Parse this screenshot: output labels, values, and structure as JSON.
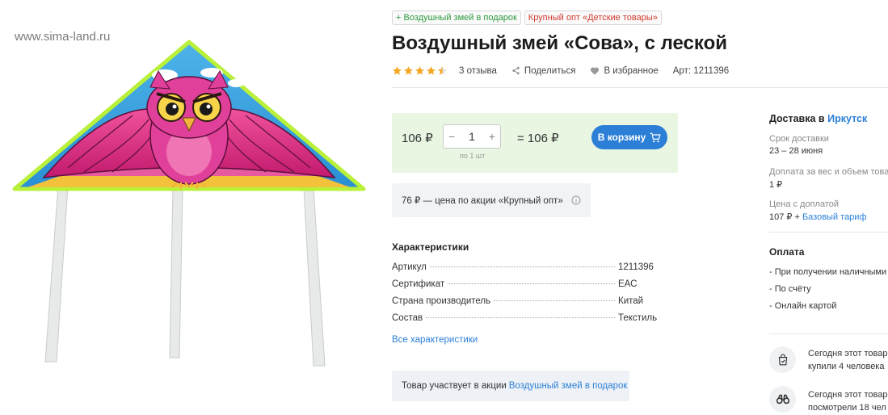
{
  "watermark": "www.sima-land.ru",
  "promo_tags": {
    "gift": "+ Воздушный змей в подарок",
    "wholesale": "Крупный опт «Детские товары»"
  },
  "product": {
    "title": "Воздушный змей «Сова», с леской",
    "rating": 4.5,
    "reviews": "3 отзыва",
    "share": "Поделиться",
    "favorite": "В избранное",
    "article": "Арт: 1211396"
  },
  "buy": {
    "price": "106 ₽",
    "qty_minus": "−",
    "quantity": "1",
    "qty_plus": "+",
    "step_note": "по 1 шт",
    "total": "= 106 ₽",
    "cart_button": "В корзину"
  },
  "promo_price": {
    "text": "76 ₽ — цена по акции «Крупный опт»",
    "info_icon": "info-icon"
  },
  "characteristics": {
    "title": "Характеристики",
    "rows": [
      {
        "key": "Артикул",
        "value": "1211396"
      },
      {
        "key": "Сертификат",
        "value": "ЕАС"
      },
      {
        "key": "Страна производитель",
        "value": "Китай"
      },
      {
        "key": "Состав",
        "value": "Текстиль"
      }
    ],
    "all_link": "Все характеристики"
  },
  "action": {
    "text": "Товар участвует в акции",
    "link": "Воздушный змей в подарок"
  },
  "sidebar": {
    "delivery_label": "Доставка в",
    "city": "Иркутск",
    "term_label": "Срок доставки",
    "term_value": "23 – 28 июня",
    "extra_label": "Доплата за вес и объем това",
    "extra_value": "1 ₽",
    "price_label": "Цена с доплатой",
    "price_value": "107 ₽ +",
    "tariff_link": "Базовый тариф",
    "payment_title": "Оплата",
    "payment_items": [
      "- При получении наличными",
      "- По счёту",
      "- Онлайн картой"
    ],
    "stats": [
      {
        "line1": "Сегодня этот товар",
        "line2": "купили 4 человека",
        "icon": "shopping-bag-icon"
      },
      {
        "line1": "Сегодня этот товар",
        "line2": "посмотрели 18 чел",
        "icon": "binoculars-icon"
      }
    ]
  },
  "colors": {
    "accent": "#2c7fd6",
    "buy_bg": "#e8f6e2",
    "star": "#f5a623",
    "gift_tag": "#2c9a3b",
    "wholesale_tag": "#d13b2f"
  }
}
